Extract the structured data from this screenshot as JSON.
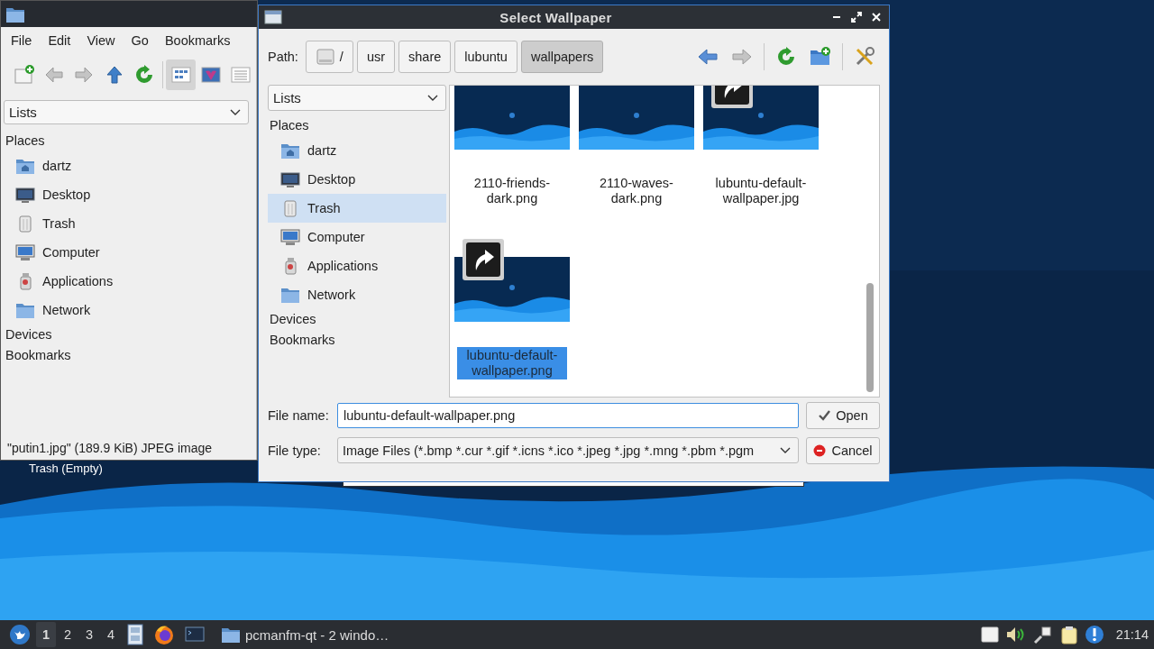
{
  "desktop": {
    "icon_label": "Trash (Empty)"
  },
  "file_manager": {
    "menu": [
      "File",
      "Edit",
      "View",
      "Go",
      "Bookmarks"
    ],
    "view_modes": [
      {
        "selected": true
      },
      {
        "selected": false
      },
      {
        "selected": false
      }
    ],
    "side_pane_mode": "Lists",
    "places_heading": "Places",
    "places": [
      {
        "label": "dartz",
        "kind": "home"
      },
      {
        "label": "Desktop",
        "kind": "desktop"
      },
      {
        "label": "Trash",
        "kind": "trash"
      },
      {
        "label": "Computer",
        "kind": "computer"
      },
      {
        "label": "Applications",
        "kind": "applications"
      },
      {
        "label": "Network",
        "kind": "network"
      }
    ],
    "sections": [
      "Devices",
      "Bookmarks"
    ],
    "status_bar": "\"putin1.jpg\" (189.9 KiB) JPEG image"
  },
  "dialog": {
    "title": "Select Wallpaper",
    "path_label": "Path:",
    "path": [
      {
        "label": "/",
        "selected": false
      },
      {
        "label": "usr",
        "selected": false
      },
      {
        "label": "share",
        "selected": false
      },
      {
        "label": "lubuntu",
        "selected": false
      },
      {
        "label": "wallpapers",
        "selected": true
      }
    ],
    "side_pane_mode": "Lists",
    "places_heading": "Places",
    "places": [
      {
        "label": "dartz",
        "kind": "home",
        "selected": false
      },
      {
        "label": "Desktop",
        "kind": "desktop",
        "selected": false
      },
      {
        "label": "Trash",
        "kind": "trash",
        "selected": true
      },
      {
        "label": "Computer",
        "kind": "computer",
        "selected": false
      },
      {
        "label": "Applications",
        "kind": "applications",
        "selected": false
      },
      {
        "label": "Network",
        "kind": "network",
        "selected": false
      }
    ],
    "sections": [
      "Devices",
      "Bookmarks"
    ],
    "files": [
      {
        "name": "2110-friends-dark.png",
        "shortcut": false,
        "selected": false
      },
      {
        "name": "2110-waves-dark.png",
        "shortcut": false,
        "selected": false
      },
      {
        "name": "lubuntu-default-wallpaper.jpg",
        "shortcut": true,
        "selected": false
      },
      {
        "name": "lubuntu-default-wallpaper.png",
        "shortcut": true,
        "selected": true
      }
    ],
    "file_name_label": "File name:",
    "file_name": "lubuntu-default-wallpaper.png",
    "open_button": "Open",
    "file_type_label": "File type:",
    "file_type": "Image Files (*.bmp *.cur *.gif *.icns *.ico *.jpeg *.jpg *.mng *.pbm *.pgm",
    "cancel_button": "Cancel"
  },
  "taskbar": {
    "workspaces": [
      {
        "label": "1",
        "selected": true
      },
      {
        "label": "2",
        "selected": false
      },
      {
        "label": "3",
        "selected": false
      },
      {
        "label": "4",
        "selected": false
      }
    ],
    "tasks": [
      {
        "label": "pcmanfm-qt - 2 windo…"
      }
    ],
    "clock": "21:14"
  }
}
